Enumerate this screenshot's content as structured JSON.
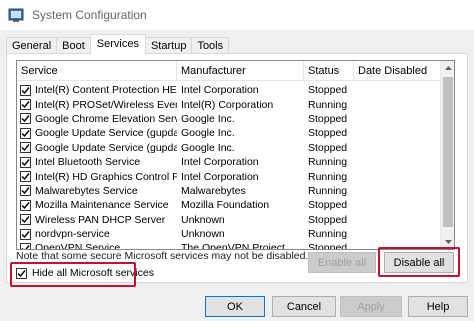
{
  "window": {
    "title": "System Configuration",
    "icon": "system-configuration-icon"
  },
  "tabs": [
    {
      "label": "General",
      "active": false
    },
    {
      "label": "Boot",
      "active": false
    },
    {
      "label": "Services",
      "active": true
    },
    {
      "label": "Startup",
      "active": false
    },
    {
      "label": "Tools",
      "active": false
    }
  ],
  "table": {
    "headers": [
      "Service",
      "Manufacturer",
      "Status",
      "Date Disabled"
    ],
    "rows": [
      {
        "service": "Intel(R) Content Protection HEC...",
        "manufacturer": "Intel Corporation",
        "status": "Stopped",
        "date_disabled": "",
        "checked": true
      },
      {
        "service": "Intel(R) PROSet/Wireless Event ...",
        "manufacturer": "Intel(R) Corporation",
        "status": "Running",
        "date_disabled": "",
        "checked": true
      },
      {
        "service": "Google Chrome Elevation Service",
        "manufacturer": "Google Inc.",
        "status": "Stopped",
        "date_disabled": "",
        "checked": true
      },
      {
        "service": "Google Update Service (gupdate)",
        "manufacturer": "Google Inc.",
        "status": "Stopped",
        "date_disabled": "",
        "checked": true
      },
      {
        "service": "Google Update Service (gupdatem)",
        "manufacturer": "Google Inc.",
        "status": "Stopped",
        "date_disabled": "",
        "checked": true
      },
      {
        "service": "Intel Bluetooth Service",
        "manufacturer": "Intel Corporation",
        "status": "Running",
        "date_disabled": "",
        "checked": true
      },
      {
        "service": "Intel(R) HD Graphics Control Pa...",
        "manufacturer": "Intel Corporation",
        "status": "Running",
        "date_disabled": "",
        "checked": true
      },
      {
        "service": "Malwarebytes Service",
        "manufacturer": "Malwarebytes",
        "status": "Running",
        "date_disabled": "",
        "checked": true
      },
      {
        "service": "Mozilla Maintenance Service",
        "manufacturer": "Mozilla Foundation",
        "status": "Stopped",
        "date_disabled": "",
        "checked": true
      },
      {
        "service": "Wireless PAN DHCP Server",
        "manufacturer": "Unknown",
        "status": "Stopped",
        "date_disabled": "",
        "checked": true
      },
      {
        "service": "nordvpn-service",
        "manufacturer": "Unknown",
        "status": "Running",
        "date_disabled": "",
        "checked": true
      },
      {
        "service": "OpenVPN Service",
        "manufacturer": "The OpenVPN Project",
        "status": "Stopped",
        "date_disabled": "",
        "checked": true
      }
    ]
  },
  "note": "Note that some secure Microsoft services may not be disabled.",
  "buttons": {
    "enable_all": "Enable all",
    "disable_all": "Disable all",
    "ok": "OK",
    "cancel": "Cancel",
    "apply": "Apply",
    "help": "Help"
  },
  "hide_ms": {
    "label": "Hide all Microsoft services",
    "checked": true
  },
  "colors": {
    "highlight": "#c8102e",
    "window_bg": "#f0f0f0"
  }
}
